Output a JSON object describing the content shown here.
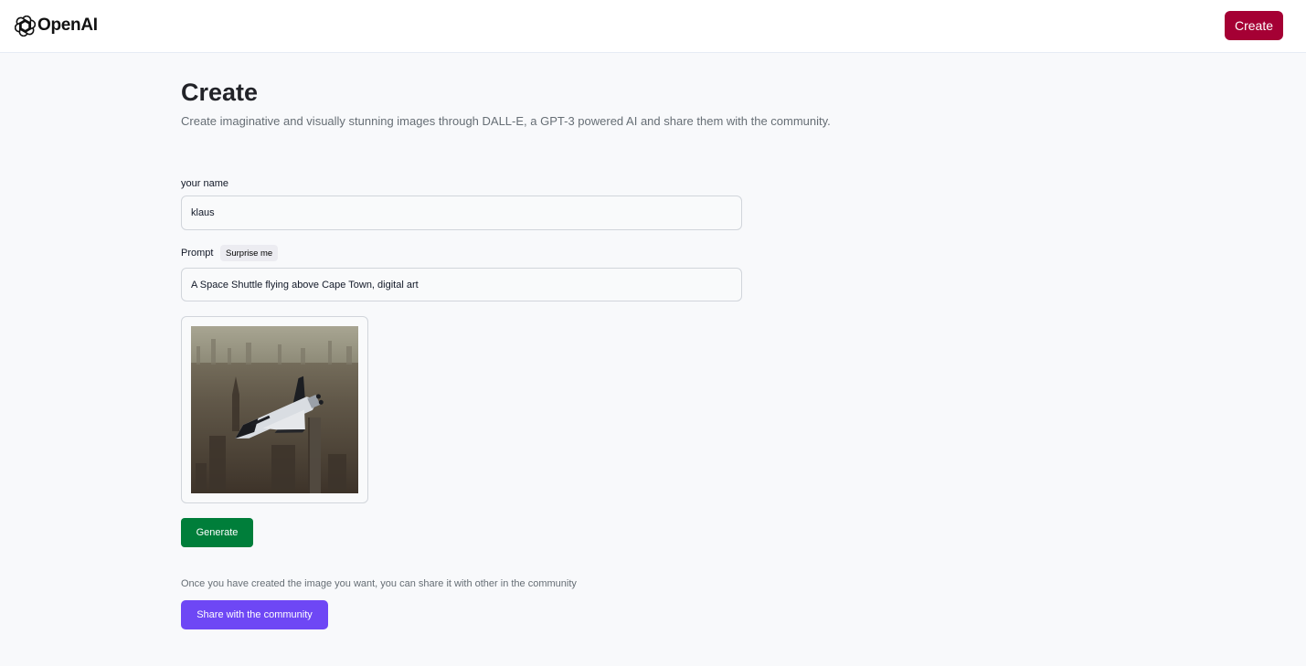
{
  "header": {
    "brand_name": "OpenAI",
    "create_label": "Create"
  },
  "page": {
    "title": "Create",
    "subtitle": "Create imaginative and visually stunning images through DALL-E, a GPT-3 powered AI and share them with the community."
  },
  "form": {
    "name_label": "your name",
    "name_value": "klaus",
    "prompt_label": "Prompt",
    "surprise_label": "Surprise me",
    "prompt_value": "A Space Shuttle flying above Cape Town, digital art"
  },
  "actions": {
    "generate_label": "Generate",
    "share_note": "Once you have created the image you want, you can share it with other in the community",
    "share_label": "Share with the community"
  },
  "colors": {
    "header_create": "#a50034",
    "generate": "#007e3a",
    "share": "#6e47f5",
    "background": "#f8f9fb"
  },
  "icons": {
    "logo": "openai-logo-icon"
  }
}
